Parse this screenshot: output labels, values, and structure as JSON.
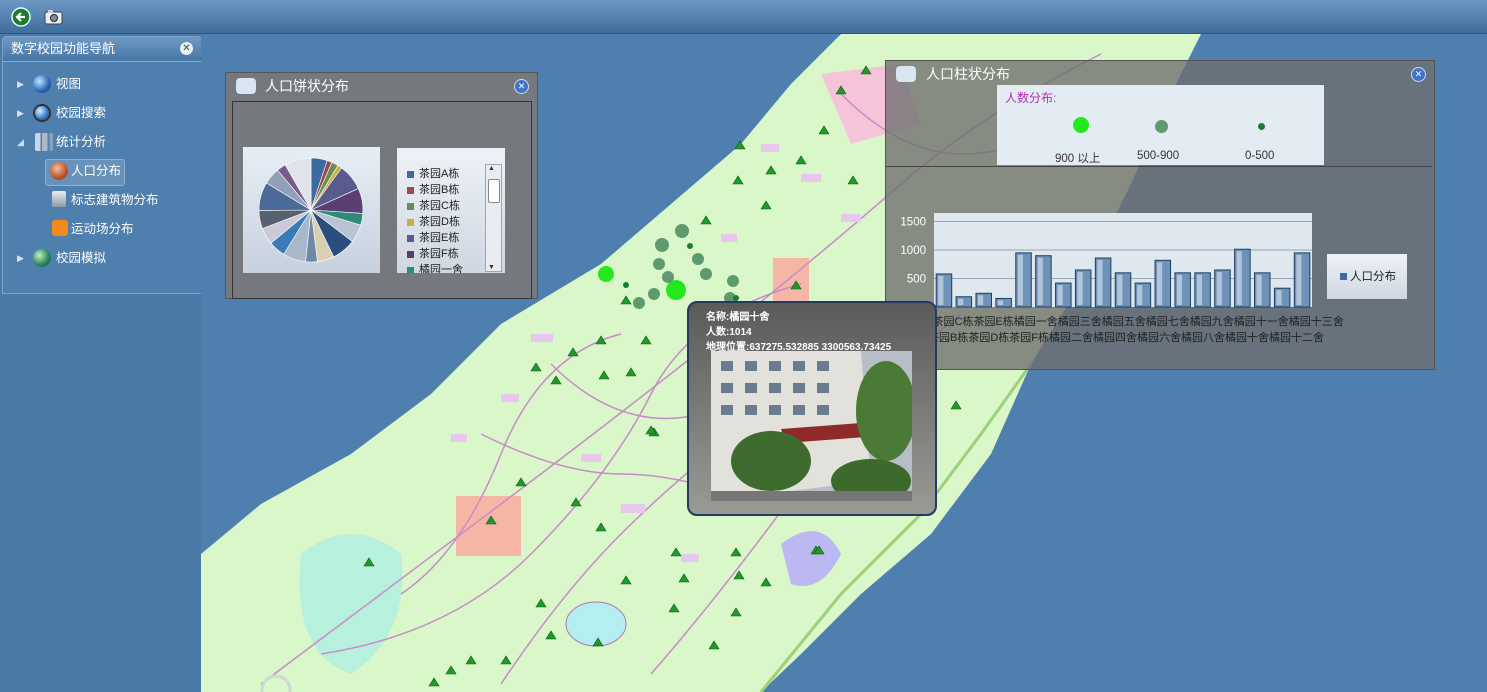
{
  "toolbar": {
    "back_icon": "back-arrow-icon",
    "camera_icon": "camera-icon"
  },
  "nav": {
    "title": "数字校园功能导航",
    "items": [
      {
        "label": "视图",
        "icon": "globe-icon",
        "expanded": false
      },
      {
        "label": "校园搜索",
        "icon": "magnifier-globe-icon",
        "expanded": false
      },
      {
        "label": "统计分析",
        "icon": "chart-icon",
        "expanded": true
      },
      {
        "label": "人口分布",
        "icon": "people-icon",
        "selected": true
      },
      {
        "label": "标志建筑物分布",
        "icon": "building-icon"
      },
      {
        "label": "运动场分布",
        "icon": "rss-icon"
      },
      {
        "label": "校园模拟",
        "icon": "globe-icon",
        "expanded": false
      }
    ]
  },
  "pie_panel": {
    "title": "人口饼状分布",
    "legend": [
      "茶园A栋",
      "茶园B栋",
      "茶园C栋",
      "茶园D栋",
      "茶园E栋",
      "茶园F栋",
      "橘园一舍"
    ],
    "legend_colors": [
      "#3d6aa0",
      "#9a4a4a",
      "#6a8a56",
      "#c9b13e",
      "#5a5a8c",
      "#5c3f72",
      "#2e8a7a"
    ]
  },
  "bar_panel": {
    "title": "人口柱状分布",
    "legend_title": "人数分布:",
    "dot_legend": [
      "900 以上",
      "500-900",
      "0-500"
    ],
    "series_legend": "人口分布"
  },
  "chart_data": {
    "type": "bar",
    "categories": [
      "茶园A栋",
      "茶园B栋",
      "茶园C栋",
      "茶园D栋",
      "茶园E栋",
      "茶园F栋",
      "橘园一舍",
      "橘园二舍",
      "橘园三舍",
      "橘园四舍",
      "橘园五舍",
      "橘园六舍",
      "橘园七舍",
      "橘园八舍",
      "橘园九舍",
      "橘园十舍",
      "橘园十一舍",
      "橘园十二舍",
      "橘园十三舍"
    ],
    "tick_row1": "茶园A栋茶园C栋茶园E栋橘园一舍橘园三舍橘园五舍橘园七舍橘园九舍橘园十一舍橘园十三舍",
    "tick_row2": "茶园B栋茶园D栋茶园F栋橘园二舍橘园四舍橘园六舍橘园八舍橘园十舍橘园十二舍",
    "series": [
      {
        "name": "人口分布",
        "values": [
          580,
          180,
          240,
          150,
          950,
          900,
          420,
          650,
          860,
          600,
          420,
          820,
          600,
          600,
          650,
          1014,
          600,
          330,
          950
        ]
      }
    ],
    "yticks": [
      500,
      1000,
      1500
    ],
    "ylim": [
      0,
      1650
    ],
    "legend": "right"
  },
  "popup": {
    "name_line": "名称:橘园十舍",
    "count_line": "人数:1014",
    "location_line": "地理位置:637275.532885  3300563.73425"
  }
}
